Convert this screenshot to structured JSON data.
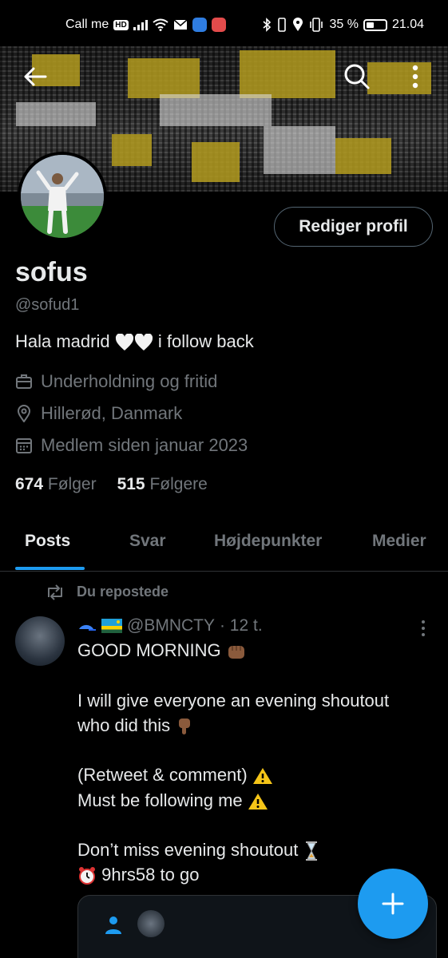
{
  "statusbar": {
    "carrier": "Call me",
    "hd": "HD",
    "battery": "35 %",
    "time": "21.04"
  },
  "profile": {
    "name": "sofus",
    "handle": "@sofud1",
    "bio_before": "Hala madrid",
    "bio_after": "i follow back",
    "category": "Underholdning og fritid",
    "location": "Hillerød, Danmark",
    "joined": "Medlem siden januar 2023",
    "edit_label": "Rediger profil",
    "following_count": "674",
    "following_label": "Følger",
    "followers_count": "515",
    "followers_label": "Følgere"
  },
  "tabs": [
    {
      "label": "Posts",
      "active": true
    },
    {
      "label": "Svar",
      "active": false
    },
    {
      "label": "Højdepunkter",
      "active": false
    },
    {
      "label": "Medier",
      "active": false
    }
  ],
  "post": {
    "repost_label": "Du repostede",
    "author_handle": "@BMNCTY",
    "time": "· 12 t.",
    "line1": "GOOD MORNING",
    "line2": "I will give everyone an evening shoutout",
    "line3": "who did this",
    "line4": "(Retweet & comment)",
    "line5": "Must be following me",
    "line6": "Don’t miss evening shoutout",
    "line7": "9hrs58 to go"
  },
  "colors": {
    "accent": "#1d9bf0",
    "muted": "#71767b",
    "text": "#e7e9ea",
    "background": "#000000"
  }
}
